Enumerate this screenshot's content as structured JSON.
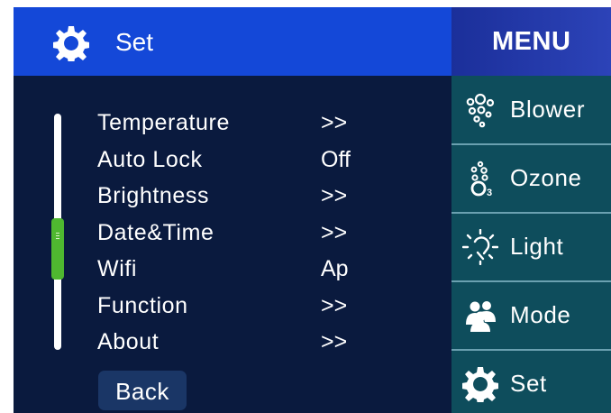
{
  "header": {
    "title": "Set",
    "icon": "gear-icon"
  },
  "settings": [
    {
      "label": "Temperature",
      "value": ">>"
    },
    {
      "label": "Auto Lock",
      "value": "Off"
    },
    {
      "label": "Brightness",
      "value": ">>"
    },
    {
      "label": "Date&Time",
      "value": ">>"
    },
    {
      "label": "Wifi",
      "value": "Ap"
    },
    {
      "label": "Function",
      "value": ">>"
    },
    {
      "label": "About",
      "value": ">>"
    }
  ],
  "back_label": "Back",
  "scroll_position": 0.6,
  "menu": {
    "title": "MENU",
    "items": [
      {
        "label": "Blower",
        "icon": "bubbles-icon"
      },
      {
        "label": "Ozone",
        "icon": "ozone-icon"
      },
      {
        "label": "Light",
        "icon": "light-bulb-icon"
      },
      {
        "label": "Mode",
        "icon": "people-icon"
      },
      {
        "label": "Set",
        "icon": "gear-icon"
      }
    ]
  },
  "colors": {
    "panel_bg": "#0a1a3e",
    "header_bg": "#1448d8",
    "menu_bg": "#0e4d5c",
    "scroll_thumb": "#4fb830"
  }
}
